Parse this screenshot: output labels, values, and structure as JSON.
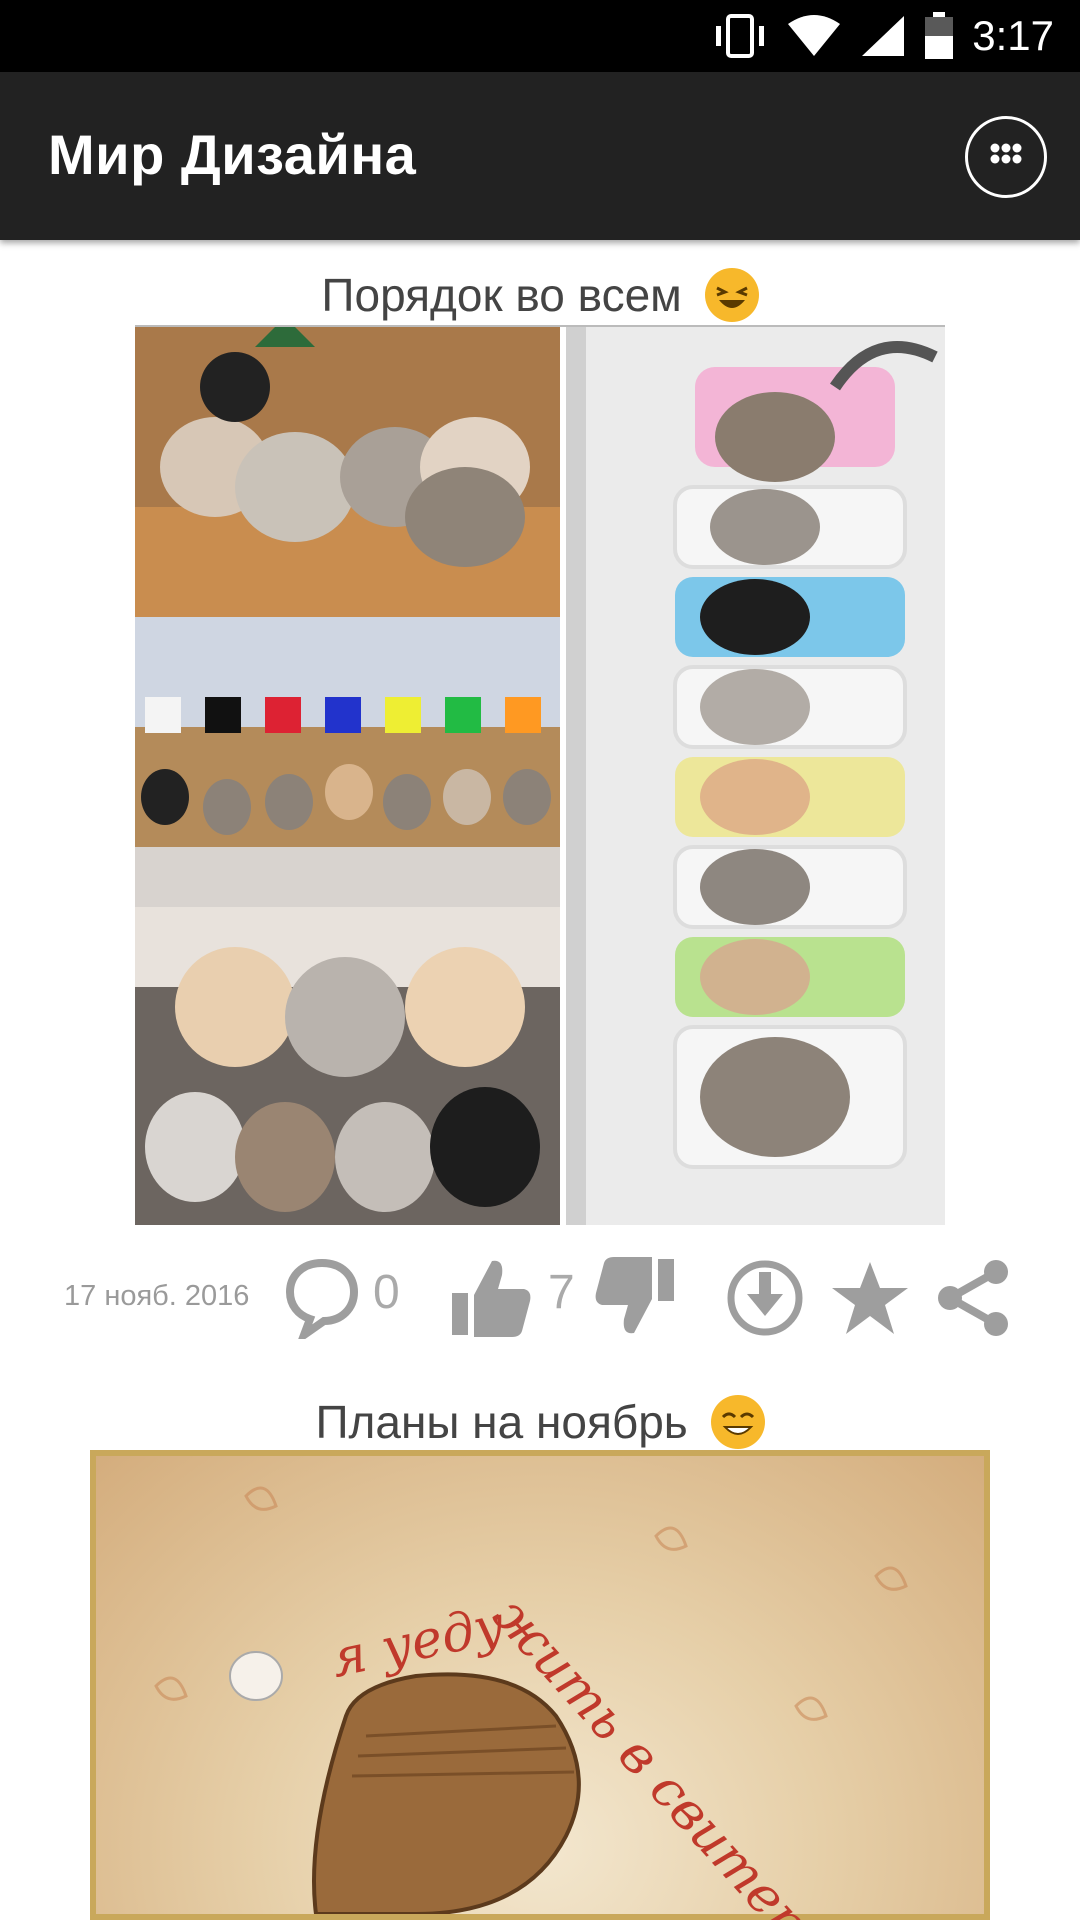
{
  "status_bar": {
    "time": "3:17",
    "icons": [
      "vibrate-icon",
      "wifi-icon",
      "cell-signal-icon",
      "battery-icon"
    ]
  },
  "app_bar": {
    "title": "Мир Дизайна",
    "menu_icon": "apps-grid-icon"
  },
  "posts": [
    {
      "title": "Порядок во всем",
      "emoji": "laughing-face",
      "image_description_icon": "cats-collage-image",
      "date": "17 нояб. 2016",
      "comments": "0",
      "likes": "7",
      "actions": [
        "comment-icon",
        "thumbs-up-icon",
        "thumbs-down-icon",
        "download-icon",
        "star-icon",
        "share-icon"
      ]
    },
    {
      "title": "Планы на ноябрь",
      "emoji": "smiling-face",
      "handwriting": {
        "line1": "я уеду",
        "line2": "жить в свитер"
      }
    }
  ],
  "colors": {
    "status_bar": "#000000",
    "app_bar": "#222222",
    "icon_gray": "#9e9e9e",
    "title_text": "#444444"
  }
}
